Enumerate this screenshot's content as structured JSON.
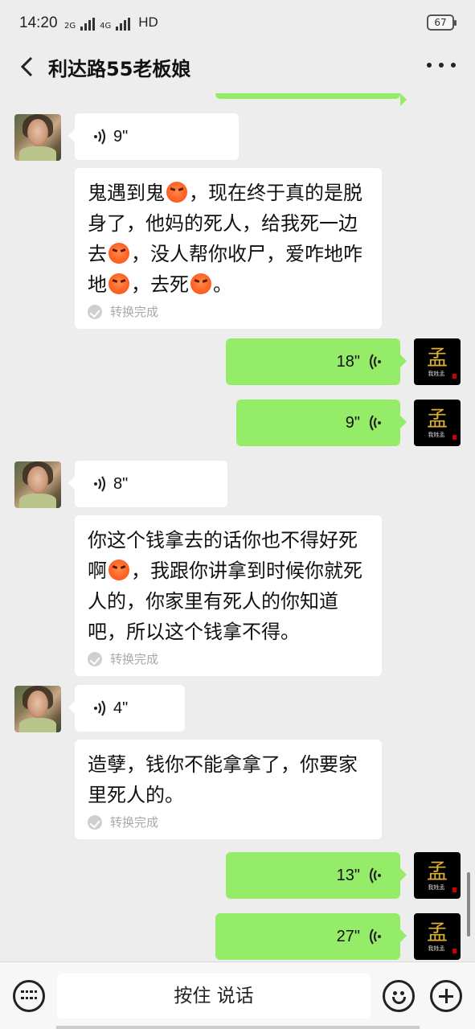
{
  "status_bar": {
    "time": "14:20",
    "net1": "2G",
    "net2": "4G",
    "hd": "HD",
    "battery": "67"
  },
  "header": {
    "title": "利达路55老板娘"
  },
  "messages": [
    {
      "voice": "9\"",
      "transcript": [
        "鬼遇到鬼",
        "，现在终于真的是脱身了，他妈的死人，给我死一边去",
        "，没人帮你收尸，爱咋地咋地",
        "，去死",
        "。"
      ],
      "status": "转换完成"
    },
    {
      "voice": "18\""
    },
    {
      "voice": "9\""
    },
    {
      "voice": "8\"",
      "transcript": [
        "你这个钱拿去的话你也不得好死啊",
        "，我跟你讲拿到时候你就死人的，你家里有死人的你知道吧，所以这个钱拿不得。"
      ],
      "status": "转换完成"
    },
    {
      "voice": "4\"",
      "transcript": [
        "造孽，钱你不能拿拿了，你要家里死人的。"
      ],
      "status": "转换完成"
    },
    {
      "voice": "13\""
    },
    {
      "voice": "27\""
    }
  ],
  "my_avatar": {
    "glyph": "孟",
    "caption": "我姓孟"
  },
  "input_bar": {
    "talk_label": "按住 说话"
  },
  "colors": {
    "out_bubble": "#95ec69",
    "in_bubble": "#ffffff",
    "background": "#ededed"
  }
}
